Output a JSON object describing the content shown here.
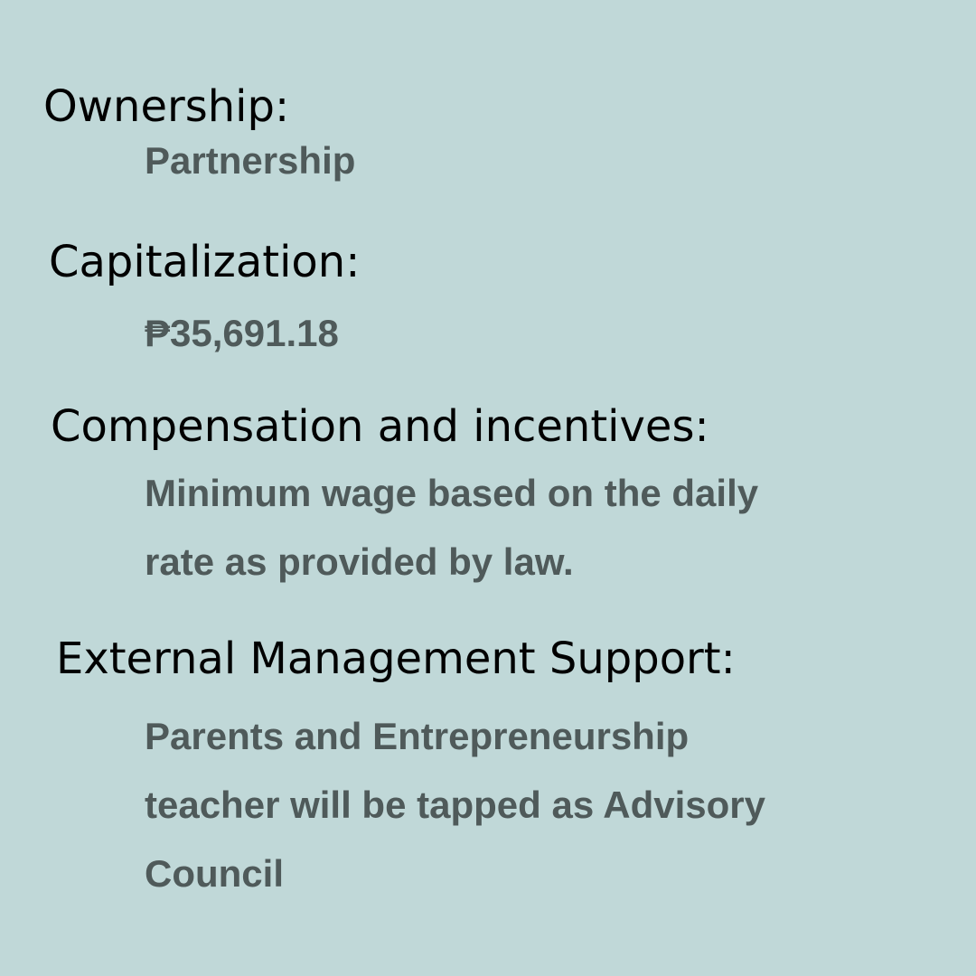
{
  "sections": [
    {
      "heading": "Ownership:",
      "lines": [
        "Partnership"
      ]
    },
    {
      "heading": "Capitalization:",
      "lines": [
        "₱35,691.18"
      ]
    },
    {
      "heading": "Compensation and incentives:",
      "lines": [
        "Minimum wage based on the daily",
        "rate as provided by law."
      ]
    },
    {
      "heading": "External Management Support:",
      "lines": [
        "Parents and Entrepreneurship",
        "teacher will be tapped as Advisory",
        "Council"
      ]
    }
  ],
  "colors": {
    "background": "#c0d8d8",
    "heading": "#000000",
    "value": "#4f5a5a"
  }
}
